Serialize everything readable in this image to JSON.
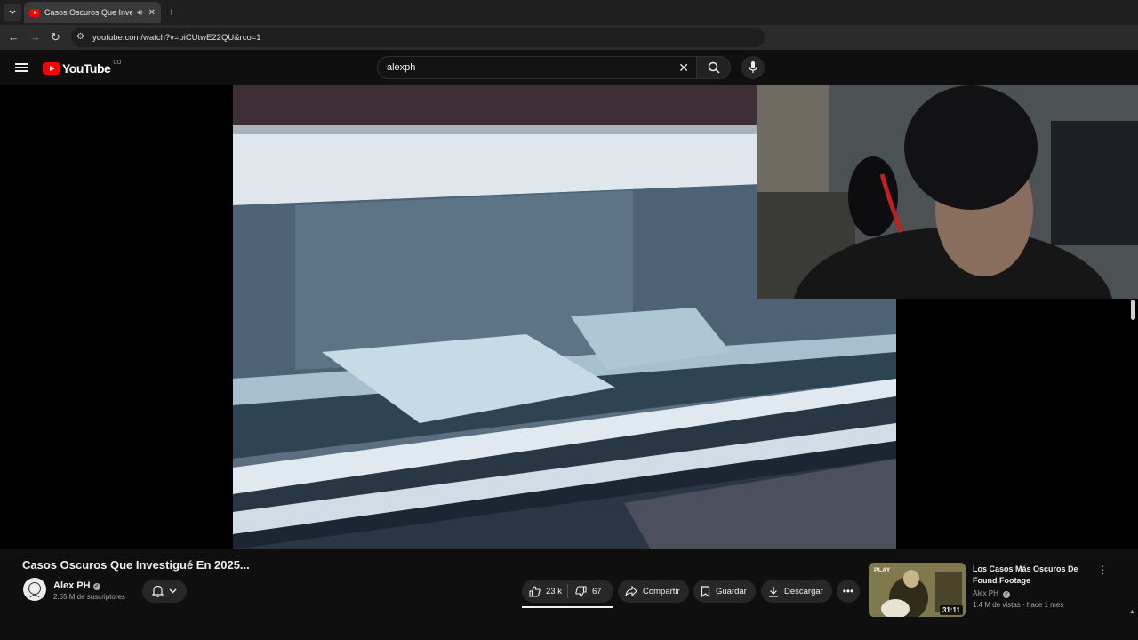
{
  "browser": {
    "tab_title": "Casos Oscuros Que Investigué En 2025...",
    "new_tab": "+",
    "close": "✕",
    "url": "youtube.com/watch?v=biCUtwE22QU&rco=1"
  },
  "youtube": {
    "logo_text": "YouTube",
    "country": "CO",
    "search_value": "alexph",
    "clear": "✕"
  },
  "video": {
    "title": "Casos Oscuros Que Investigué En 2025...",
    "channel": "Alex PH",
    "verified": true,
    "subscribers": "2.55 M de suscriptores",
    "likes": "23 k",
    "dislikes": "67",
    "share_label": "Compartir",
    "save_label": "Guardar",
    "download_label": "Descargar"
  },
  "related": {
    "title": "Los Casos Más Oscuros De Found Footage",
    "channel": "Alex PH",
    "views": "1.4 M de vistas",
    "age": "hace 1 mes",
    "meta_separator": " · ",
    "duration": "31:11",
    "badge": "PLAY"
  },
  "icons": [
    "tab-list-icon",
    "youtube-favicon-icon",
    "speaker-icon",
    "close-icon",
    "back-icon",
    "forward-icon",
    "reload-icon",
    "site-info-icon",
    "menu-icon",
    "youtube-logo-icon",
    "search-icon",
    "mic-icon",
    "bell-icon",
    "chevron-down-icon",
    "like-icon",
    "dislike-icon",
    "share-icon",
    "save-icon",
    "download-icon",
    "more-icon",
    "verified-icon"
  ],
  "colors": {
    "brand_red": "#ff0000",
    "background": "#0f0f0f",
    "pill": "#272727"
  }
}
